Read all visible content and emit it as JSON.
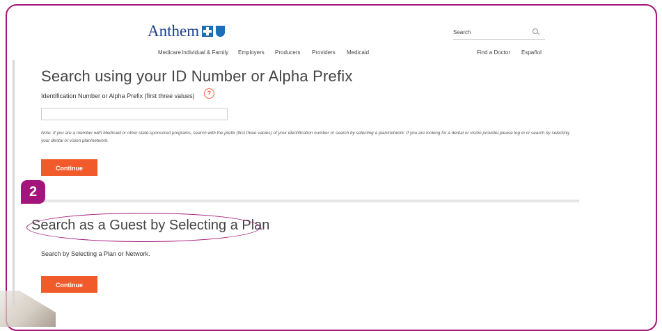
{
  "header": {
    "logo_text": "Anthem",
    "search": {
      "placeholder": "Search"
    },
    "nav_main": [
      "Medicare",
      "Individual & Family",
      "Employers",
      "Producers",
      "Providers",
      "Medicaid"
    ],
    "nav_right": [
      "Find a Doctor",
      "Español"
    ]
  },
  "id_section": {
    "title": "Search using your ID Number or Alpha Prefix",
    "field_label": "Identification Number or Alpha Prefix (first three values)",
    "help_glyph": "?",
    "input_value": "",
    "note": "Note: If you are a member with Medicaid or other state-sponsored programs, search with the prefix (first three values) of your identification number or search by selecting a plan/network. If you are looking for a dental or vision provider,please log in or search by selecting your dental or vision plan/network.",
    "continue_label": "Continue"
  },
  "guest_section": {
    "step_number": "2",
    "title": "Search as a Guest by Selecting a Plan",
    "text": "Search by Selecting a Plan or Network.",
    "continue_label": "Continue"
  },
  "colors": {
    "accent": "#a3157a",
    "button": "#f15a2b",
    "brand_blue": "#1a3e8c"
  }
}
